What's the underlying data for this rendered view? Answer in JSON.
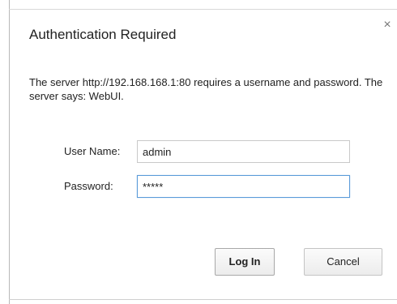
{
  "dialog": {
    "title": "Authentication Required",
    "close_glyph": "×",
    "message": "The server http://192.168.168.1:80 requires a username and password. The server says: WebUI.",
    "username_label": "User Name:",
    "username_value": "admin",
    "password_label": "Password:",
    "password_value": "*****",
    "login_label": "Log In",
    "cancel_label": "Cancel"
  },
  "colors": {
    "focus_border": "#5b9bd9",
    "text": "#222222"
  },
  "icons": {
    "close": "close-icon"
  }
}
